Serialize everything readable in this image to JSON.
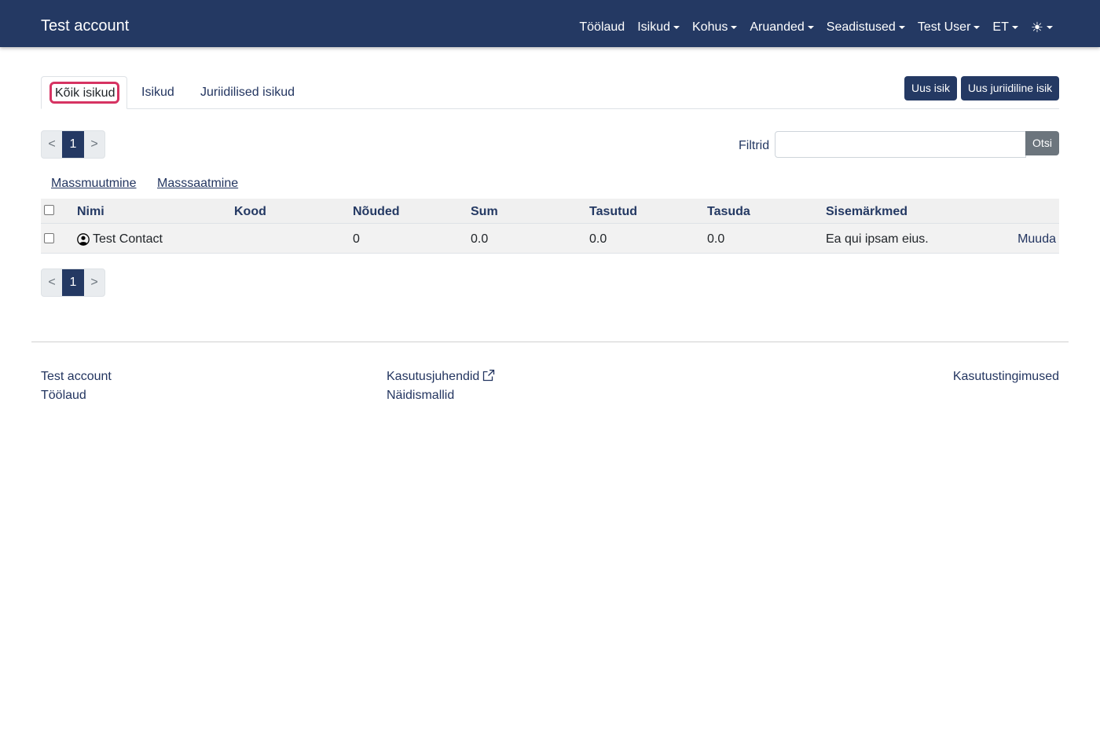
{
  "navbar": {
    "brand": "Test account",
    "items": [
      {
        "label": "Töölaud",
        "dropdown": false
      },
      {
        "label": "Isikud",
        "dropdown": true
      },
      {
        "label": "Kohus",
        "dropdown": true
      },
      {
        "label": "Aruanded",
        "dropdown": true
      },
      {
        "label": "Seadistused",
        "dropdown": true
      },
      {
        "label": "Test User",
        "dropdown": true
      },
      {
        "label": "ET",
        "dropdown": true
      }
    ],
    "theme_icon": "sun-icon"
  },
  "tabs": [
    {
      "label": "Kõik isikud",
      "active": true
    },
    {
      "label": "Isikud",
      "active": false
    },
    {
      "label": "Juriidilised isikud",
      "active": false
    }
  ],
  "actions": {
    "new_person": "Uus isik",
    "new_legal_person": "Uus juriidiline isik"
  },
  "pagination": {
    "prev": "<",
    "current_page": "1",
    "next": ">"
  },
  "filter": {
    "label": "Filtrid",
    "value": "",
    "search_button": "Otsi"
  },
  "mass_actions": {
    "mass_edit": "Massmuutmine",
    "mass_send": "Masssaatmine"
  },
  "table": {
    "columns": [
      "Nimi",
      "Kood",
      "Nõuded",
      "Sum",
      "Tasutud",
      "Tasuda",
      "Sisemärkmed"
    ],
    "rows": [
      {
        "name": "Test Contact",
        "code": "",
        "claims": "0",
        "sum": "0.0",
        "paid": "0.0",
        "due": "0.0",
        "notes": "Ea qui ipsam eius.",
        "edit": "Muuda"
      }
    ]
  },
  "footer": {
    "account": "Test account",
    "dashboard": "Töölaud",
    "manuals": "Kasutusjuhendid",
    "templates": "Näidismallid",
    "terms": "Kasutustingimused"
  },
  "colors": {
    "primary": "#243963",
    "active_focus": "#d63362",
    "secondary_button": "#6c757d"
  }
}
